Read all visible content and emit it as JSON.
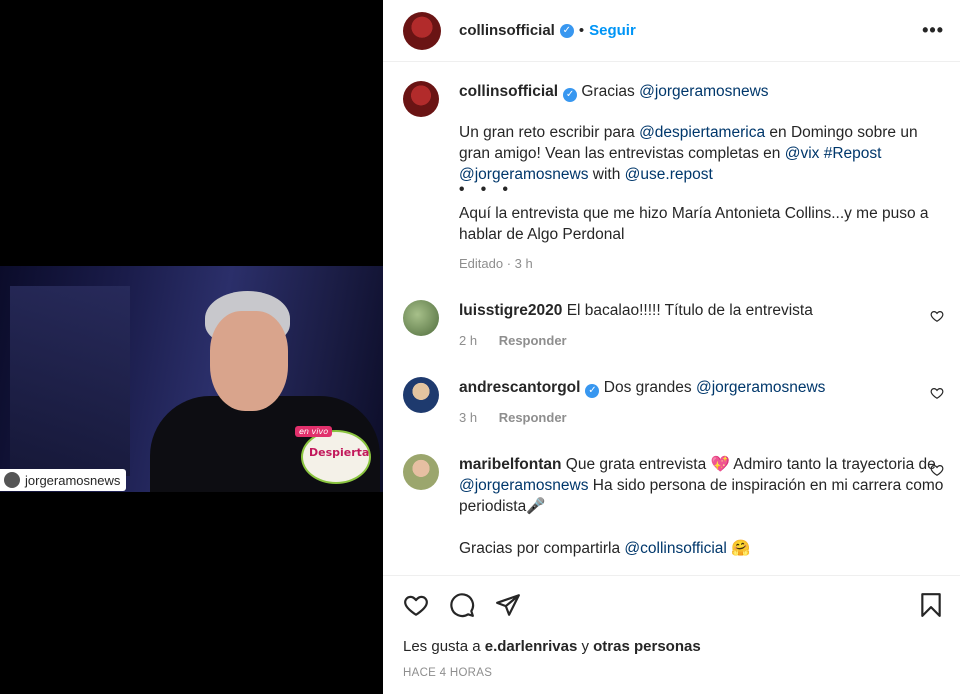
{
  "media": {
    "tag_username": "jorgeramosnews",
    "show_badge": "en vivo",
    "show_name": "Despierta"
  },
  "header": {
    "username": "collinsofficial",
    "dot": "•",
    "follow_label": "Seguir",
    "more_label": "•••"
  },
  "caption": {
    "username": "collinsofficial",
    "text_gracias": "Gracias",
    "mention_jorge": "@jorgeramosnews",
    "p1_a": "Un gran reto escribir para",
    "p1_mention1": "@despiertamerica",
    "p1_b": "en Domingo sobre un gran amigo! Vean las entrevistas completas en",
    "p1_mention2": "@vix",
    "p1_hashtag": "#Repost",
    "p1_mention3": "@jorgeramosnews",
    "p1_c": "with",
    "p1_mention4": "@use.repost",
    "dots": "• • •",
    "p2": "Aquí la entrevista que me hizo María Antonieta Collins...y me puso a hablar de Algo Perdonal",
    "meta": "Editado · 3 h"
  },
  "comments": [
    {
      "username": "luisstigre2020",
      "text": "El bacalao!!!!! Título de la entrevista",
      "time": "2 h",
      "reply": "Responder"
    },
    {
      "username": "andrescantorgol",
      "text_a": "Dos grandes",
      "mention": "@jorgeramosnews",
      "time": "3 h",
      "reply": "Responder"
    },
    {
      "username": "maribelfontan",
      "text_a": "Que grata entrevista 💖 Admiro tanto la trayectoria de",
      "mention": "@jorgeramosnews",
      "text_b": "Ha sido persona de inspiración en mi carrera como periodista🎤",
      "text_c": "Gracias por compartirla",
      "mention2": "@collinsofficial",
      "emoji": "🤗"
    }
  ],
  "footer": {
    "likes_prefix": "Les gusta a",
    "likes_user": "e.darlenrivas",
    "likes_and": "y",
    "likes_others": "otras personas",
    "time": "HACE 4 HORAS"
  }
}
